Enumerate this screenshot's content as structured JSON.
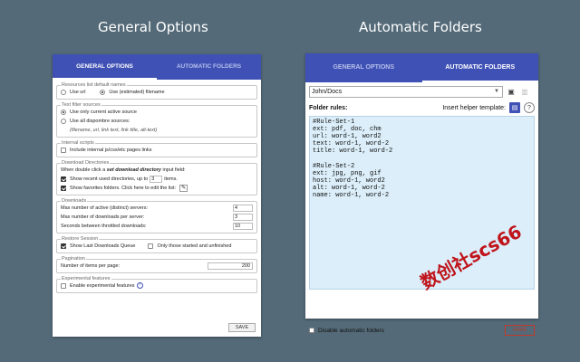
{
  "headings": {
    "left": "General Options",
    "right": "Automatic Folders"
  },
  "tabs": {
    "general": "GENERAL OPTIONS",
    "auto": "AUTOMATIC FOLDERS"
  },
  "general": {
    "resources": {
      "legend": "Resources list default names",
      "opt_url": "Use url",
      "opt_filename": "Use (estimated) filename"
    },
    "textfilter": {
      "legend": "Text filter sources",
      "opt_current": "Use only current active source",
      "opt_all": "Use all dispombre sources:",
      "opt_all_sub": "(filename, url, link text, link title, alt-text)"
    },
    "internal": {
      "legend": "Internal scripts",
      "include": "Include internal js/css/etc pages links"
    },
    "dldirs": {
      "legend": "Download Directories",
      "dblclick_prefix": "When double click a",
      "dblclick_bold": "set download directory",
      "dblclick_suffix": "input field:",
      "recent": "Show recent used directories, up to",
      "recent_count": "3",
      "recent_suffix": "items.",
      "favorites": "Show favorites folders. Click here to edit the list:"
    },
    "downloads": {
      "legend": "Downloads",
      "max_active": "Max number of active (distinct) servers:",
      "max_active_val": "4",
      "max_per_server": "Max number of downloads per server:",
      "max_per_server_val": "3",
      "throttle": "Seconds between throttled downloads:",
      "throttle_val": "10"
    },
    "restore": {
      "legend": "Restore Session",
      "show_last": "Show Last Downloads Queue",
      "only_started": "Only those started and unfinished"
    },
    "pagination": {
      "legend": "Pagination",
      "items_per_page": "Number of items per page:",
      "items_val": "200"
    },
    "experimental": {
      "legend": "Experimental features",
      "enable": "Enable experimental features"
    },
    "save": "SAVE"
  },
  "auto": {
    "folder": "John/Docs",
    "rules_label": "Folder rules:",
    "insert_template": "Insert helper template:",
    "rules_text": "#Rule-Set-1\next: pdf, doc, chm\nurl: word-1, word2\ntext: word-1, word-2\ntitle: word-1, word-2\n\n#Rule-Set-2\next: jpg, png, gif\nhost: word-1, word2\nalt: word-1, word-2\nname: word-1, word-2",
    "disable": "Disable automatic folders",
    "save": "SAVE"
  },
  "watermark": "数创社scs66"
}
